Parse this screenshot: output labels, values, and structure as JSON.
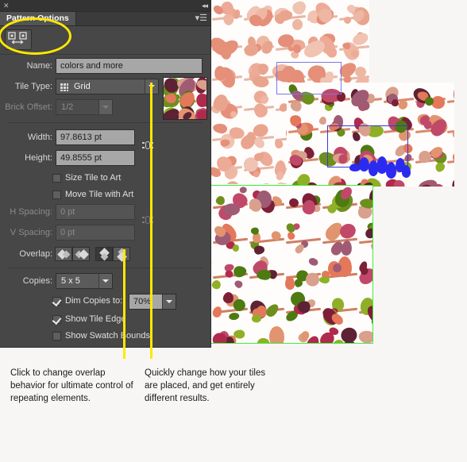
{
  "window": {
    "close_icon": "close-x-icon",
    "collapse_icon": "double-chevron-left-icon"
  },
  "panel": {
    "tab_label": "Pattern Options",
    "menu_icon": "panel-menu-icon",
    "tile_tool_icon": "pattern-tile-tool-icon",
    "fields": {
      "name_label": "Name:",
      "name_value": "colors and more",
      "tile_type_label": "Tile Type:",
      "tile_type_value": "Grid",
      "tile_type_icon": "grid-icon",
      "brick_offset_label": "Brick Offset:",
      "brick_offset_value": "1/2",
      "width_label": "Width:",
      "width_value": "97.8613 pt",
      "height_label": "Height:",
      "height_value": "49.8555 pt",
      "size_tile_to_art_label": "Size Tile to Art",
      "size_tile_to_art_checked": false,
      "move_tile_with_art_label": "Move Tile with Art",
      "move_tile_with_art_checked": false,
      "h_spacing_label": "H Spacing:",
      "h_spacing_value": "0 pt",
      "v_spacing_label": "V Spacing:",
      "v_spacing_value": "0 pt",
      "overlap_label": "Overlap:",
      "copies_label": "Copies:",
      "copies_value": "5 x 5",
      "dim_copies_label": "Dim Copies to:",
      "dim_copies_checked": true,
      "dim_copies_value": "70%",
      "show_tile_edge_label": "Show Tile Edge",
      "show_tile_edge_checked": true,
      "show_swatch_bounds_label": "Show Swatch Bounds",
      "show_swatch_bounds_checked": false
    },
    "overlap_buttons": [
      {
        "name": "overlap-left-in-front",
        "icon": "diamond-left-front-icon",
        "active": false
      },
      {
        "name": "overlap-right-in-front",
        "icon": "diamond-right-front-icon",
        "active": false
      },
      {
        "name": "overlap-top-in-front",
        "icon": "diamond-top-front-icon",
        "active": true
      },
      {
        "name": "overlap-bottom-in-front",
        "icon": "diamond-bottom-front-icon",
        "active": false
      }
    ],
    "link_icons": [
      "size-link-icon",
      "spacing-link-icon"
    ]
  },
  "annotations": {
    "highlight_color": "#ffe800",
    "ellipse_name": "pattern-tile-tool-highlight",
    "callout_left": "Click to change overlap behavior for ultimate control of repeating elements.",
    "callout_right": "Quickly change how your tiles are placed, and get entirely different results."
  },
  "artboard": {
    "background_color": "#f8f6f4",
    "tile_edge_color": "#7b79e8",
    "swatch_bounds_color": "#3ef03e",
    "selection_color": "#2b2bf0"
  }
}
